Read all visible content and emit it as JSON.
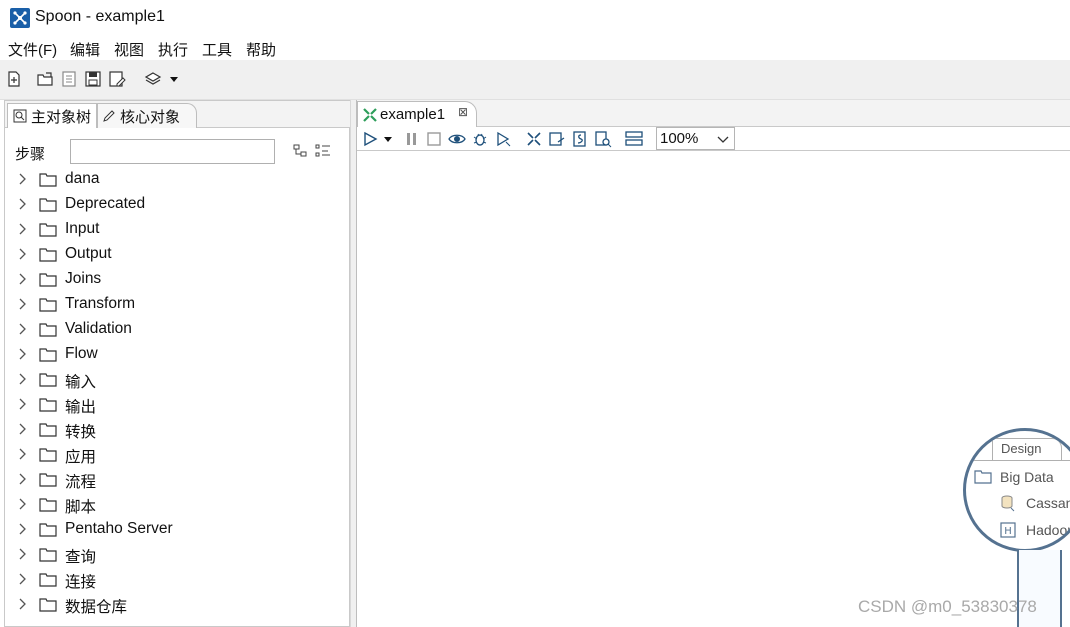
{
  "window": {
    "title": "Spoon - example1"
  },
  "menu": [
    {
      "label": "文件(F)"
    },
    {
      "label": "编辑"
    },
    {
      "label": "视图"
    },
    {
      "label": "执行"
    },
    {
      "label": "工具"
    },
    {
      "label": "帮助"
    }
  ],
  "left": {
    "tabs": [
      {
        "label": "主对象树"
      },
      {
        "label": "核心对象"
      }
    ],
    "steps_label": "步骤",
    "search_value": "",
    "tree": [
      {
        "label": "dana"
      },
      {
        "label": "Deprecated"
      },
      {
        "label": "Input"
      },
      {
        "label": "Output"
      },
      {
        "label": "Joins"
      },
      {
        "label": "Transform"
      },
      {
        "label": "Validation"
      },
      {
        "label": "Flow"
      },
      {
        "label": "输入"
      },
      {
        "label": "输出"
      },
      {
        "label": "转换"
      },
      {
        "label": "应用"
      },
      {
        "label": "流程"
      },
      {
        "label": "脚本"
      },
      {
        "label": "Pentaho Server"
      },
      {
        "label": "查询"
      },
      {
        "label": "连接"
      },
      {
        "label": "数据仓库"
      }
    ]
  },
  "editor": {
    "tab_label": "example1",
    "zoom": "100%"
  },
  "magnifier": {
    "tab": "Design",
    "folder": "Big Data",
    "items": [
      "Cassan",
      "Hadoop"
    ]
  },
  "watermark": "CSDN @m0_53830378",
  "colors": {
    "accent": "#1a5fa8",
    "green_icon": "#2e9e5b",
    "frame": "#557290"
  }
}
